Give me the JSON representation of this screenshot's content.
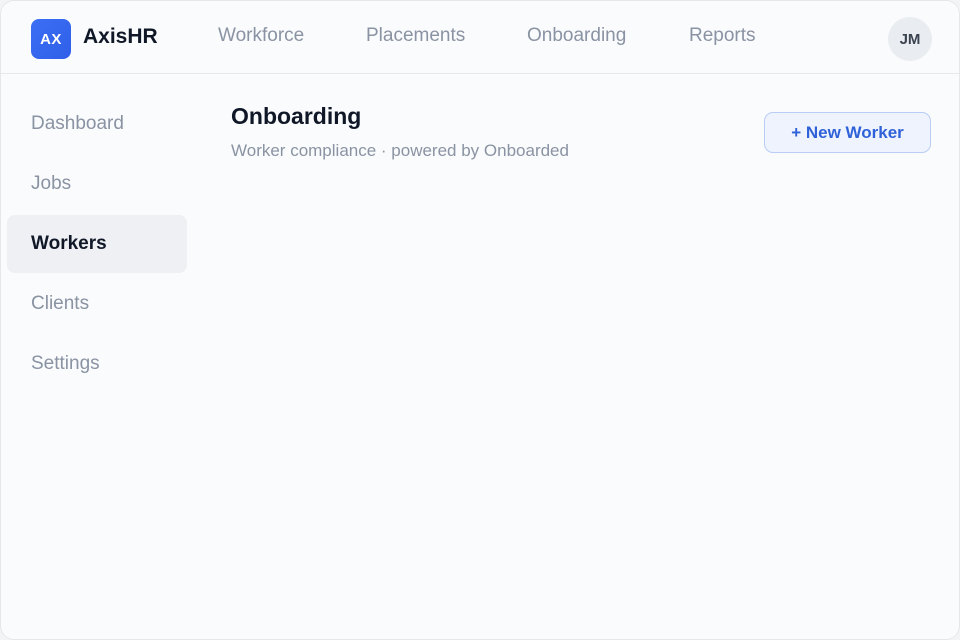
{
  "header": {
    "logo_text": "AX",
    "brand": "AxisHR",
    "nav": [
      {
        "label": "Workforce"
      },
      {
        "label": "Placements"
      },
      {
        "label": "Onboarding"
      },
      {
        "label": "Reports"
      }
    ],
    "avatar_initials": "JM"
  },
  "sidebar": {
    "items": [
      {
        "label": "Dashboard"
      },
      {
        "label": "Jobs"
      },
      {
        "label": "Workers",
        "active": true
      },
      {
        "label": "Clients"
      },
      {
        "label": "Settings"
      }
    ]
  },
  "main": {
    "title": "Onboarding",
    "subtitle": "Worker compliance · powered by Onboarded",
    "new_button_label": "+ New Worker"
  },
  "colors": {
    "accent": "#2f62d8",
    "logo_bg": "#3b6ef5",
    "text_primary": "#101828",
    "text_muted": "#8a93a3"
  }
}
